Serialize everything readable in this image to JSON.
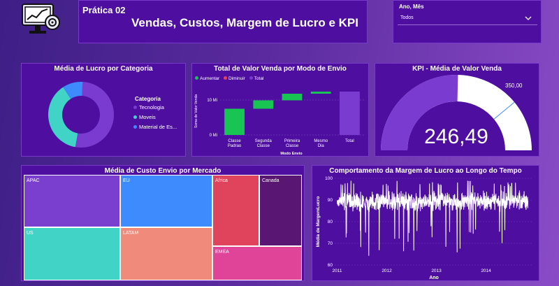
{
  "header": {
    "subtitle": "Prática 02",
    "title": "Vendas, Custos, Margem de Lucro e KPI"
  },
  "filter": {
    "label": "Ano, Mês",
    "value": "Todos"
  },
  "colors": {
    "panel": "#4e0fa0",
    "teal": "#40d3c6",
    "blue": "#3d8bfd",
    "purple": "#7b3fd0",
    "green": "#18c452",
    "red": "#e0435c",
    "gauge": "#7a3bd1"
  },
  "donut": {
    "title": "Média de Lucro por Categoria",
    "legend_title": "Categoria",
    "items": [
      {
        "label": "Tecnologia",
        "color": "#7a3bd1",
        "value": 52
      },
      {
        "label": "Moveis",
        "color": "#40d3c6",
        "value": 38
      },
      {
        "label": "Material de Es...",
        "color": "#3d8bfd",
        "value": 10
      }
    ]
  },
  "waterfall": {
    "title": "Total de Valor Venda por Modo de Envio",
    "legend": [
      "Aumentar",
      "Diminuir",
      "Total"
    ],
    "legend_colors": [
      "#18c452",
      "#e0435c",
      "#7a3bd1"
    ],
    "ylabel": "Soma de Valor Venda",
    "xlabel": "Modo Envio",
    "ticks": [
      "10 Mi",
      "0 Mi"
    ]
  },
  "kpi": {
    "title": "KPI - Média de Valor Venda",
    "value": "246,49",
    "target": "350,00"
  },
  "treemap": {
    "title": "Média de Custo Envio por Mercado",
    "tiles": [
      {
        "label": "APAC",
        "color": "#7b3fd0"
      },
      {
        "label": "EU",
        "color": "#3d8bfd"
      },
      {
        "label": "Africa",
        "color": "#e0435c"
      },
      {
        "label": "Canada",
        "color": "#5a1673"
      },
      {
        "label": "US",
        "color": "#40d3c6"
      },
      {
        "label": "LATAM",
        "color": "#f08a7a"
      },
      {
        "label": "EMEA",
        "color": "#e04498"
      }
    ]
  },
  "chart_data": [
    {
      "type": "pie",
      "title": "Média de Lucro por Categoria",
      "categories": [
        "Tecnologia",
        "Moveis",
        "Material de Es..."
      ],
      "values": [
        52,
        38,
        10
      ],
      "legend": "right"
    },
    {
      "type": "bar",
      "title": "Total de Valor Venda por Modo de Envio",
      "categories": [
        "Classe Padrao",
        "Segunda Classe",
        "Primeira Classe",
        "Mesmo Dia",
        "Total"
      ],
      "series": [
        {
          "name": "Aumentar",
          "values": [
            7.5,
            2.4,
            1.9,
            0.6,
            null
          ]
        },
        {
          "name": "Total",
          "values": [
            null,
            null,
            null,
            null,
            12.4
          ]
        }
      ],
      "xlabel": "Modo Envio",
      "ylabel": "Soma de Valor Venda",
      "ylim": [
        0,
        14
      ],
      "legend": "top-left"
    },
    {
      "type": "line",
      "title": "Comportamento da Margem de Lucro ao Longo do Tempo",
      "xlabel": "Ano",
      "ylabel": "Média de MargemLucro",
      "xlim": [
        2011,
        2015
      ],
      "ylim": [
        60,
        100
      ],
      "x_ticks": [
        "2011",
        "2012",
        "2013",
        "2014"
      ],
      "y_ticks": [
        "60",
        "70",
        "80",
        "90",
        "100"
      ],
      "band": [
        84,
        95
      ]
    }
  ]
}
